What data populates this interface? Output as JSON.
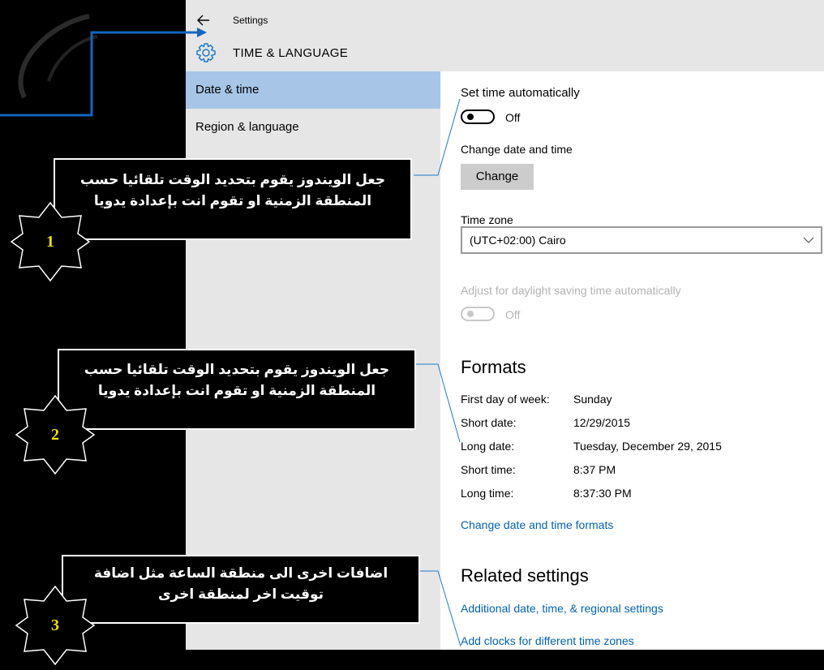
{
  "window": {
    "app_title": "Settings",
    "section_title": "TIME & LANGUAGE",
    "back_icon": "back-arrow-icon",
    "section_icon": "gear-icon"
  },
  "sidebar": {
    "items": [
      {
        "label": "Date & time",
        "selected": true
      },
      {
        "label": "Region & language",
        "selected": false
      }
    ]
  },
  "content": {
    "set_time_auto": {
      "label": "Set time automatically",
      "state": "Off"
    },
    "change_date_time": {
      "label": "Change date and time",
      "button": "Change"
    },
    "time_zone": {
      "label": "Time zone",
      "value": "(UTC+02:00) Cairo"
    },
    "daylight": {
      "label": "Adjust for daylight saving time automatically",
      "state": "Off",
      "disabled": true
    },
    "formats": {
      "heading": "Formats",
      "rows": [
        {
          "key": "First day of week:",
          "value": "Sunday"
        },
        {
          "key": "Short date:",
          "value": "12/29/2015"
        },
        {
          "key": "Long date:",
          "value": "Tuesday, December 29, 2015"
        },
        {
          "key": "Short time:",
          "value": "8:37 PM"
        },
        {
          "key": "Long time:",
          "value": "8:37:30 PM"
        }
      ],
      "link": "Change date and time formats"
    },
    "related": {
      "heading": "Related settings",
      "links": [
        "Additional date, time, & regional settings",
        "Add clocks for different time zones"
      ]
    }
  },
  "annotations": [
    {
      "number": "1",
      "lines": [
        "جعل الويندوز يقوم بتحديد الوقت تلقائيا حسب",
        "المنطقة الزمنية او تقوم انت بإعدادة يدويا"
      ]
    },
    {
      "number": "2",
      "lines": [
        "جعل الويندوز يقوم بتحديد الوقت تلقائيا حسب",
        "المنطقة الزمنية او تقوم انت بإعدادة يدويا"
      ]
    },
    {
      "number": "3",
      "lines": [
        "اضافات اخرى الى منطقة الساعة مثل اضافة",
        "توقيت اخر لمنطقة اخرى"
      ]
    }
  ],
  "colors": {
    "sidebar_bg": "#e6e6e6",
    "selected_bg": "#a7c6e7",
    "link": "#0063b1",
    "callout_bg": "#000000",
    "badge_number": "#f2e000",
    "arrow": "#1565c0"
  }
}
